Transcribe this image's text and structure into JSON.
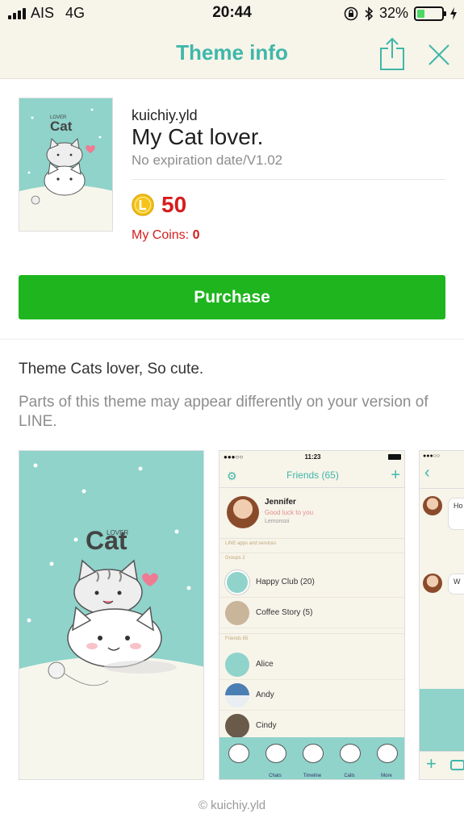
{
  "status_bar": {
    "carrier": "AIS",
    "network": "4G",
    "time": "20:44",
    "battery": "32%"
  },
  "header": {
    "title": "Theme info"
  },
  "theme": {
    "author": "kuichiy.yld",
    "name": "My Cat lover.",
    "expiry": "No expiration date/V1.02",
    "price": "50",
    "my_coins_label": "My Coins:",
    "my_coins_value": "0",
    "thumb_lover": "LOVER",
    "thumb_cat": "Cat"
  },
  "purchase_label": "Purchase",
  "description": "Theme Cats lover, So cute.",
  "note": "Parts of this theme may appear differently on your version of LINE.",
  "preview_home": {
    "lover": "LOVER",
    "cat": "Cat"
  },
  "preview_friends": {
    "time": "11:23",
    "title": "Friends (65)",
    "profile": {
      "name": "Jennifer",
      "status": "Good luck to you",
      "song": "Lemonsoi"
    },
    "sections": {
      "apps": "LINE apps and services",
      "groups": "Groups 2",
      "friends": "Friends 65"
    },
    "groups": [
      "Happy Club (20)",
      "Coffee Story (5)"
    ],
    "friends": [
      "Alice",
      "Andy",
      "Cindy"
    ],
    "tabs": [
      "",
      "Chats",
      "Timeline",
      "Calls",
      "More"
    ]
  },
  "preview_chat": {
    "bubbles": [
      "Ho wi",
      "W"
    ]
  },
  "footer": "© kuichiy.yld",
  "colors": {
    "accent": "#3fb7a9",
    "purchase": "#1eb51e",
    "price": "#d51d1d",
    "mint": "#8fd3cb"
  }
}
